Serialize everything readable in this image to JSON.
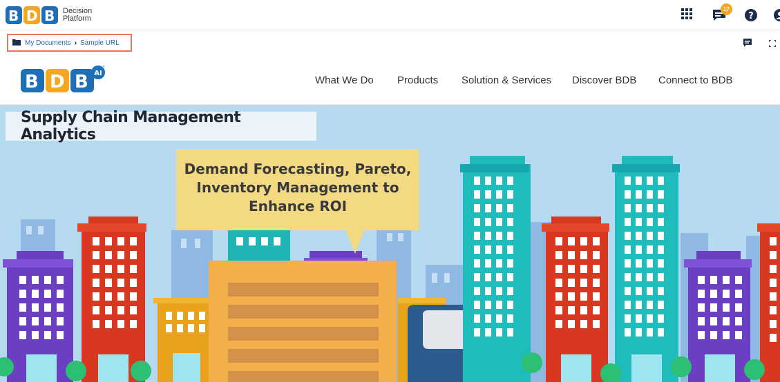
{
  "app": {
    "logo_line1": "Decision",
    "logo_line2": "Platform",
    "notification_count": "17"
  },
  "breadcrumb": {
    "items": [
      "My Documents",
      "Sample URL"
    ]
  },
  "site": {
    "logo_badge": "AI",
    "nav": [
      "What We Do",
      "Products",
      "Solution & Services",
      "Discover BDB",
      "Connect to BDB"
    ],
    "hero_title": "Supply Chain Management Analytics",
    "hero_lines": [
      "Demand Forecasting, Pareto,",
      "Inventory Management to",
      "Enhance ROI"
    ]
  },
  "icons": {
    "apps": "grid-icon",
    "notifications": "chat-notification-icon",
    "help": "help-icon",
    "user": "user-icon",
    "folder": "folder-icon",
    "comment": "comment-icon",
    "fullscreen": "fullscreen-icon"
  },
  "colors": {
    "breadcrumb_border": "#e8775b",
    "brand_blue": "#1e6fb8",
    "brand_orange": "#f5a623",
    "sky": "#b5daf0"
  }
}
